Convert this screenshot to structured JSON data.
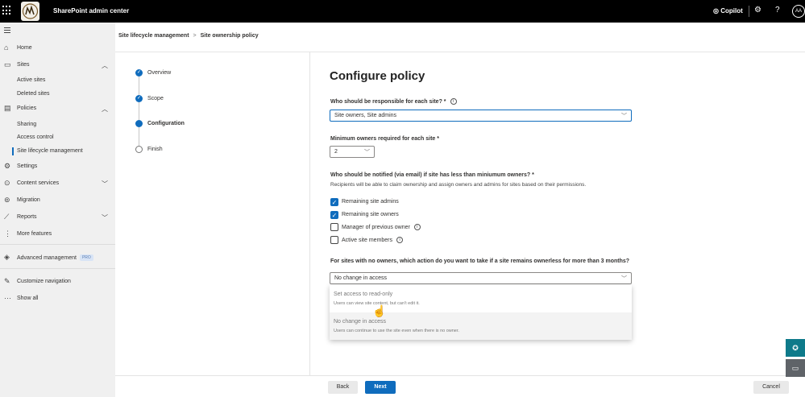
{
  "app": {
    "title": "SharePoint admin center",
    "copilot_label": "Copilot",
    "avatar_initials": "AA"
  },
  "nav": {
    "items": [
      {
        "label": "Home",
        "icon": "home-icon"
      },
      {
        "label": "Sites",
        "icon": "sites-icon",
        "expanded": true
      },
      {
        "label": "Active sites",
        "sub": true
      },
      {
        "label": "Deleted sites",
        "sub": true
      },
      {
        "label": "Policies",
        "icon": "policies-icon",
        "expanded": true
      },
      {
        "label": "Sharing",
        "sub": true
      },
      {
        "label": "Access control",
        "sub": true
      },
      {
        "label": "Site lifecycle management",
        "sub": true,
        "active": true
      },
      {
        "label": "Settings",
        "icon": "gear-icon"
      },
      {
        "label": "Content services",
        "icon": "content-services-icon",
        "expanded": false
      },
      {
        "label": "Migration",
        "icon": "migration-icon"
      },
      {
        "label": "Reports",
        "icon": "reports-icon",
        "expanded": false
      },
      {
        "label": "More features",
        "icon": "more-features-icon"
      },
      {
        "label": "Advanced management",
        "icon": "advanced-management-icon",
        "badge": "PRO"
      },
      {
        "label": "Customize navigation",
        "icon": "pencil-icon"
      },
      {
        "label": "Show all",
        "icon": "ellipsis-icon"
      }
    ]
  },
  "breadcrumb": {
    "parent": "Site lifecycle management",
    "separator": ">",
    "current": "Site ownership policy"
  },
  "steps": [
    {
      "label": "Overview",
      "state": "complete"
    },
    {
      "label": "Scope",
      "state": "complete"
    },
    {
      "label": "Configuration",
      "state": "current"
    },
    {
      "label": "Finish",
      "state": "pending"
    }
  ],
  "form": {
    "heading": "Configure policy",
    "responsible_question": "Who should be responsible for each site? *",
    "responsible_value": "Site owners, Site admins",
    "min_owners_question": "Minimum owners required for each site *",
    "min_owners_value": "2",
    "notify_question": "Who should be notified (via email) if site has less than miniumum owners? *",
    "notify_description": "Recipients will be able to claim ownership and assign owners and admins for sites based on their permissions.",
    "checkboxes": [
      {
        "label": "Remaining site admins",
        "checked": true,
        "info": false
      },
      {
        "label": "Remaining site owners",
        "checked": true,
        "info": false
      },
      {
        "label": "Manager of previous owner",
        "checked": false,
        "info": true
      },
      {
        "label": "Active site members",
        "checked": false,
        "info": true
      }
    ],
    "no_owner_question": "For sites with no owners, which action do you want to take if a site remains ownerless for more than 3 months?",
    "no_owner_value": "No change in access",
    "options": [
      {
        "title": "Set access to read-only",
        "description": "Users can view site content, but can't edit it."
      },
      {
        "title": "No change in access",
        "description": "Users can continue to use the site even when there is no owner."
      }
    ]
  },
  "footer": {
    "back_label": "Back",
    "next_label": "Next",
    "cancel_label": "Cancel"
  },
  "colors": {
    "accent": "#0f6cbd",
    "teal": "#0e7a8a",
    "gray_fab": "#5f6368"
  }
}
